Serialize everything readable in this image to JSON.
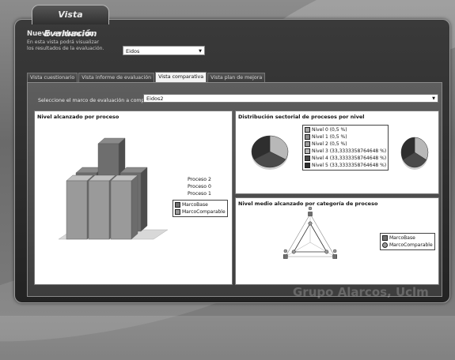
{
  "window": {
    "title": "Vista Evaluación"
  },
  "header": {
    "section_title": "Nueva evaluación",
    "description": "En esta vista podrá visualizar los resultados de la evaluación.",
    "selector_value": "Eidos"
  },
  "tabs": [
    {
      "label": "Vista cuestionario",
      "active": false
    },
    {
      "label": "Vista informe de evaluación",
      "active": false
    },
    {
      "label": "Vista comparativa",
      "active": true
    },
    {
      "label": "Vista plan de mejora",
      "active": false
    }
  ],
  "comparison": {
    "frame_label": "Seleccione el marco de evaluación a comparar",
    "frame_value": "Eidos2"
  },
  "colors": {
    "series_base": "#6e6e6e",
    "series_comparable": "#9a9a9a",
    "level_0": "#a8a8a8",
    "level_1": "#8e8e8e",
    "level_2": "#9c9c9c",
    "level_3": "#b8b8b8",
    "level_4": "#4a4a4a",
    "level_5": "#2e2e2e"
  },
  "chart_data": [
    {
      "type": "bar",
      "title": "Nivel alcanzado por proceso",
      "categories": [
        "Proceso 2",
        "Proceso 0",
        "Proceso 1"
      ],
      "series": [
        {
          "name": "MarcoBase",
          "values": [
            2,
            3,
            2
          ]
        },
        {
          "name": "MarcoComparable",
          "values": [
            2,
            2,
            2
          ]
        }
      ],
      "ylim": [
        0,
        3
      ],
      "three_d": true,
      "legend_placement": "right"
    },
    {
      "type": "pie",
      "title": "Distribución sectorial de procesos por nivel",
      "legend": [
        "Nivel 0 (0,5 %)",
        "Nivel 1 (0,5 %)",
        "Nivel 2 (0,5 %)",
        "Nivel 3 (33,3333358764648 %)",
        "Nivel 4 (33,3333358764648 %)",
        "Nivel 5 (33,3333358764648 %)"
      ],
      "pies": [
        {
          "values": [
            0,
            0,
            0,
            33.3333358764648,
            33.3333358764648,
            33.3333358764648
          ]
        },
        {
          "values": [
            0,
            0,
            0,
            33.3333358764648,
            33.3333358764648,
            33.3333358764648
          ]
        }
      ],
      "legend_placement": "center"
    },
    {
      "type": "radar",
      "title": "Nivel medio alcanzado por categoría de proceso",
      "axes": [
        "",
        "",
        ""
      ],
      "series": [
        {
          "name": "MarcoBase",
          "values": [
            2,
            2,
            2
          ]
        },
        {
          "name": "MarcoComparable",
          "values": [
            2,
            2,
            2
          ]
        }
      ],
      "max": 3,
      "legend_placement": "right"
    }
  ],
  "watermark": "Grupo Alarcos, Uclm"
}
